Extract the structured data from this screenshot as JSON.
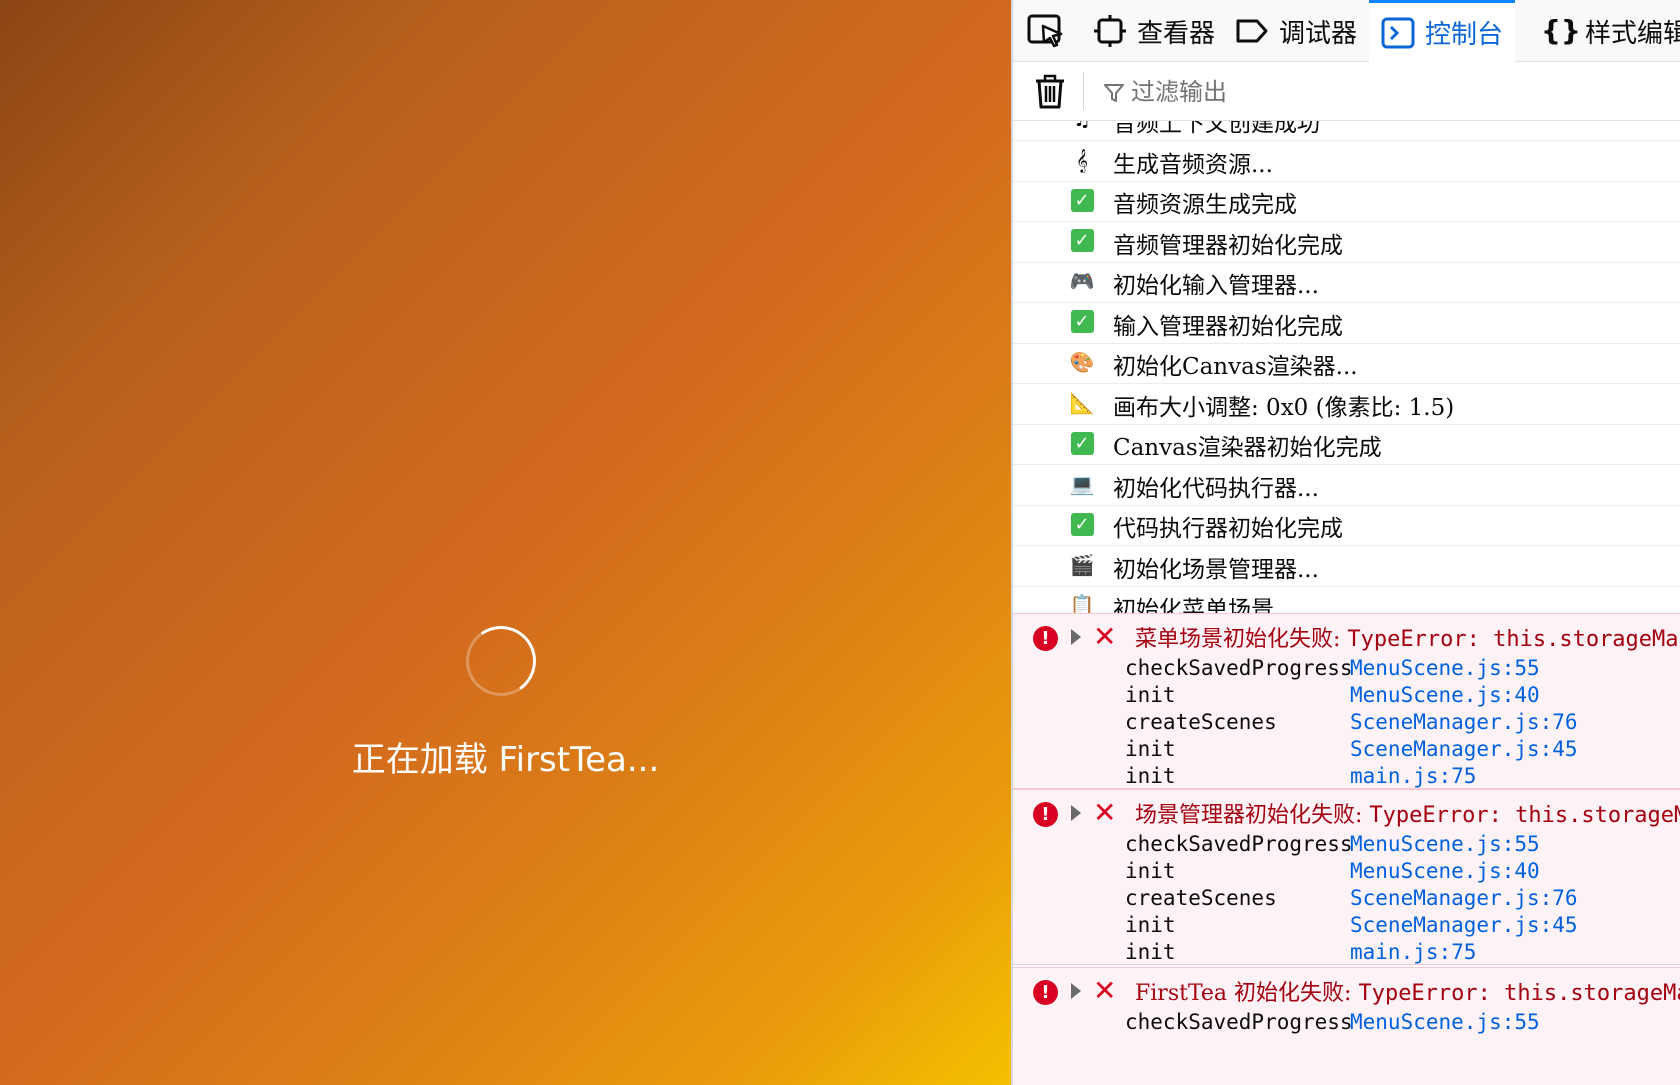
{
  "game": {
    "loading_text": "正在加载 FirstTea..."
  },
  "devtools": {
    "tabs": [
      {
        "label": "查看器",
        "icon": "inspector-icon"
      },
      {
        "label": "调试器",
        "icon": "debugger-icon"
      },
      {
        "label": "控制台",
        "icon": "console-icon",
        "selected": true
      },
      {
        "label": "样式编辑器",
        "icon": "style-editor-icon"
      }
    ],
    "filter_placeholder": "过滤输出",
    "log": [
      {
        "icon": "♫",
        "text": "音频上下文创建成功"
      },
      {
        "icon": "𝄞",
        "text": "生成音频资源..."
      },
      {
        "icon": "✓",
        "text": "音频资源生成完成"
      },
      {
        "icon": "✓",
        "text": "音频管理器初始化完成"
      },
      {
        "icon": "🎮",
        "text": "初始化输入管理器..."
      },
      {
        "icon": "✓",
        "text": "输入管理器初始化完成"
      },
      {
        "icon": "🎨",
        "text": "初始化Canvas渲染器..."
      },
      {
        "icon": "📐",
        "text": "画布大小调整: 0x0 (像素比: 1.5)"
      },
      {
        "icon": "✓",
        "text": "Canvas渲染器初始化完成"
      },
      {
        "icon": "💻",
        "text": "初始化代码执行器..."
      },
      {
        "icon": "✓",
        "text": "代码执行器初始化完成"
      },
      {
        "icon": "🎬",
        "text": "初始化场景管理器..."
      },
      {
        "icon": "📋",
        "text": "初始化菜单场景..."
      }
    ],
    "errors": [
      {
        "message": "菜单场景初始化失败:",
        "error": "TypeError: this.storageManager",
        "stack": [
          {
            "fn": "checkSavedProgress",
            "loc": "MenuScene.js:55"
          },
          {
            "fn": "init",
            "loc": "MenuScene.js:40"
          },
          {
            "fn": "createScenes",
            "loc": "SceneManager.js:76"
          },
          {
            "fn": "init",
            "loc": "SceneManager.js:45"
          },
          {
            "fn": "init",
            "loc": "main.js:75"
          }
        ]
      },
      {
        "message": "场景管理器初始化失败:",
        "error": "TypeError: this.storageManager",
        "stack": [
          {
            "fn": "checkSavedProgress",
            "loc": "MenuScene.js:55"
          },
          {
            "fn": "init",
            "loc": "MenuScene.js:40"
          },
          {
            "fn": "createScenes",
            "loc": "SceneManager.js:76"
          },
          {
            "fn": "init",
            "loc": "SceneManager.js:45"
          },
          {
            "fn": "init",
            "loc": "main.js:75"
          }
        ]
      },
      {
        "message": "FirstTea 初始化失败:",
        "error": "TypeError: this.storageManager",
        "stack": [
          {
            "fn": "checkSavedProgress",
            "loc": "MenuScene.js:55"
          }
        ]
      }
    ]
  }
}
